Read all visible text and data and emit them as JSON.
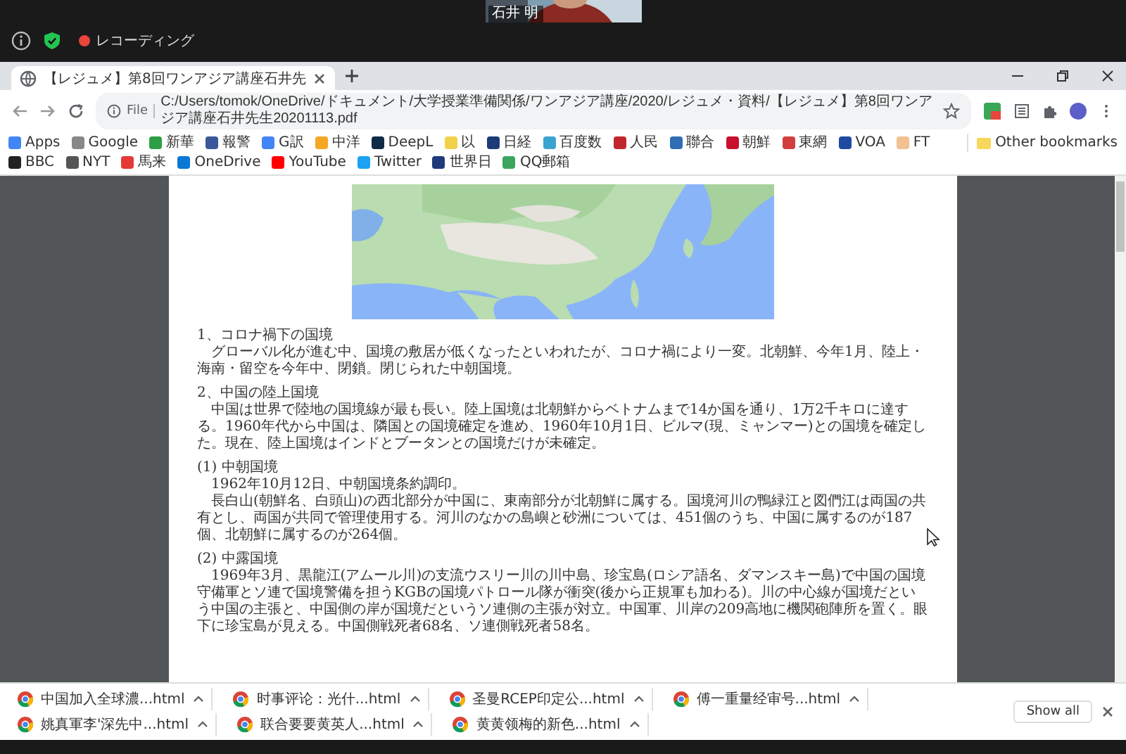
{
  "meeting": {
    "participant_name": "石井 明",
    "recording_label": "レコーディング"
  },
  "browser": {
    "tab": {
      "title": "【レジュメ】第8回ワンアジア講座石井先"
    },
    "address": {
      "scheme": "File",
      "path": "C:/Users/tomok/OneDrive/ドキュメント/大学授業準備関係/ワンアジア講座/2020/レジュメ・資料/【レジュメ】第8回ワンアジア講座石井先生20201113.pdf"
    },
    "bookmarks": [
      {
        "label": "Apps",
        "color": "#4285f4"
      },
      {
        "label": "Google",
        "color": "#888888"
      },
      {
        "label": "新華",
        "color": "#2e9e44"
      },
      {
        "label": "報警",
        "color": "#3b5998"
      },
      {
        "label": "G訳",
        "color": "#4285f4"
      },
      {
        "label": "中洋",
        "color": "#f5a623"
      },
      {
        "label": "DeepL",
        "color": "#0f2b46"
      },
      {
        "label": "以",
        "color": "#f2d14a"
      },
      {
        "label": "日経",
        "color": "#1d3b77"
      },
      {
        "label": "百度数",
        "color": "#3ba3d0"
      },
      {
        "label": "人民",
        "color": "#c0272d"
      },
      {
        "label": "聯合",
        "color": "#2f6db5"
      },
      {
        "label": "朝鮮",
        "color": "#c8102e"
      },
      {
        "label": "東網",
        "color": "#d23e3e"
      },
      {
        "label": "VOA",
        "color": "#1e4aa0"
      },
      {
        "label": "FT",
        "color": "#f2c091"
      },
      {
        "label": "BBC",
        "color": "#222222"
      },
      {
        "label": "NYT",
        "color": "#555555"
      },
      {
        "label": "馬来",
        "color": "#e53935"
      },
      {
        "label": "OneDrive",
        "color": "#0a78d4"
      },
      {
        "label": "YouTube",
        "color": "#ff0000"
      },
      {
        "label": "Twitter",
        "color": "#1da1f2"
      },
      {
        "label": "世界日",
        "color": "#1f3a7a"
      },
      {
        "label": "QQ郵箱",
        "color": "#3ba55d"
      }
    ],
    "other_bookmarks": "Other bookmarks"
  },
  "document": {
    "sections": [
      {
        "kind": "heading",
        "text": "1、コロナ禍下の国境"
      },
      {
        "kind": "paragraph",
        "text": "グローバル化が進む中、国境の敷居が低くなったといわれたが、コロナ禍により一変。北朝鮮、今年1月、陸上・海南・留空を今年中、閉鎖。閉じられた中朝国境。"
      },
      {
        "kind": "heading",
        "text": "2、中国の陸上国境"
      },
      {
        "kind": "paragraph",
        "text": "中国は世界で陸地の国境線が最も長い。陸上国境は北朝鮮からベトナムまで14か国を通り、1万2千キロに達する。1960年代から中国は、隣国との国境確定を進め、1960年10月1日、ビルマ(現、ミャンマー)との国境を確定した。現在、陸上国境はインドとブータンとの国境だけが未確定。"
      },
      {
        "kind": "subheading",
        "text": "(1) 中朝国境"
      },
      {
        "kind": "paragraph",
        "text": "1962年10月12日、中朝国境条約調印。"
      },
      {
        "kind": "paragraph",
        "text": "長白山(朝鮮名、白頭山)の西北部分が中国に、東南部分が北朝鮮に属する。国境河川の鴨緑江と図們江は両国の共有とし、両国が共同で管理使用する。河川のなかの島嶼と砂洲については、451個のうち、中国に属するのが187個、北朝鮮に属するのが264個。"
      },
      {
        "kind": "subheading",
        "text": "(2) 中露国境"
      },
      {
        "kind": "paragraph",
        "text": "1969年3月、黒龍江(アムール川)の支流ウスリー川の川中島、珍宝島(ロシア語名、ダマンスキー島)で中国の国境守備軍とソ連で国境警備を担うKGBの国境パトロール隊が衝突(後から正規軍も加わる)。川の中心線が国境だという中国の主張と、中国側の岸が国境だというソ連側の主張が対立。中国軍、川岸の209高地に機関砲陣所を置く。眼下に珍宝島が見える。中国側戦死者68名、ソ連側戦死者58名。"
      }
    ]
  },
  "downloads": {
    "items": [
      "中国加入全球濃...html",
      "时事评论：光什...html",
      "圣曼RCEP印定公...html",
      "傅一重量经审号...html",
      "姚真軍李'深先中...html",
      "联合要要黄英人...html",
      "黄黄领梅的新色...html"
    ],
    "show_all": "Show all"
  }
}
